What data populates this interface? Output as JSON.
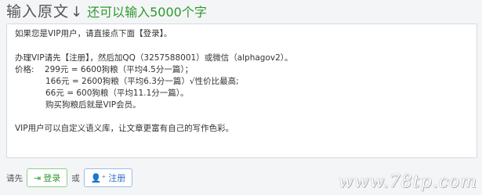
{
  "header": {
    "title": "输入原文",
    "hint": "还可以输入5000个字"
  },
  "editor": {
    "lines": [
      "如果您是VIP用户，请直接点下面【登录】。",
      "办理VIP请先【注册】，然后加QQ（3257588001）或微信（alphagov2）。",
      "价格:    299元 = 6600狗粮（平均4.5分一篇）；",
      "166元 = 2600狗粮（平均6.3分一篇）√性价比最高;",
      "66元 = 600狗粮（平均11.1分一篇）。",
      "购买狗粮后就是VIP会员。",
      "VIP用户可以自定义语义库，让文章更富有自己的写作色彩。"
    ]
  },
  "footer": {
    "prefix": "请先",
    "login_label": "登录",
    "or": "或",
    "register_label": "注册"
  },
  "watermark": "www.78tp.com"
}
